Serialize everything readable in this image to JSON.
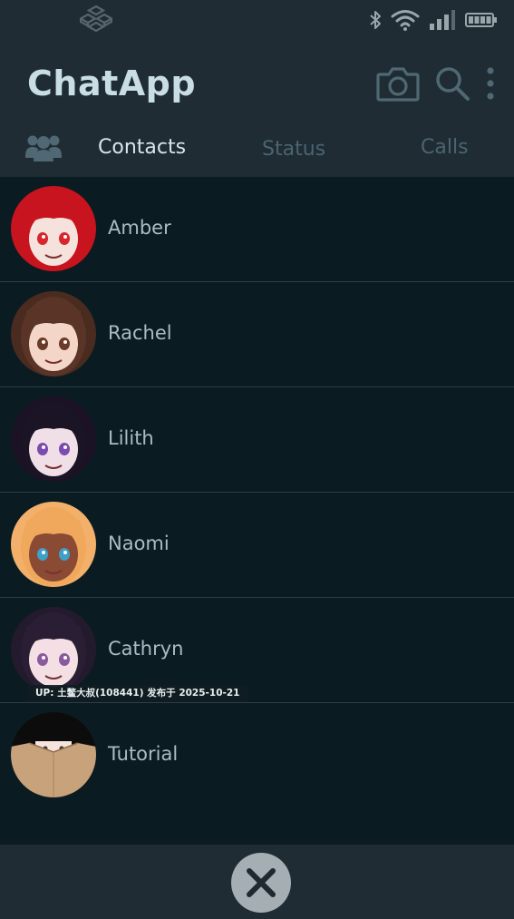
{
  "app": {
    "title": "ChatApp"
  },
  "statusbar": {
    "icons": [
      "app-logo-icon",
      "bluetooth-icon",
      "wifi-icon",
      "signal-icon",
      "battery-icon"
    ]
  },
  "header": {
    "actions": [
      "camera-icon",
      "search-icon",
      "more-vert-icon"
    ]
  },
  "tabs": {
    "community_icon": "community-icon",
    "items": [
      {
        "label": "Contacts",
        "active": true
      },
      {
        "label": "Status",
        "active": false
      },
      {
        "label": "Calls",
        "active": false
      }
    ]
  },
  "contacts": [
    {
      "name": "Amber",
      "hair": "#c8141e",
      "eyes": "#d8262c",
      "skin": "#f6e2dc",
      "bg": "#c8141e"
    },
    {
      "name": "Rachel",
      "hair": "#5a3527",
      "eyes": "#6b3a28",
      "skin": "#f3d6c8",
      "bg": "#4a2b20"
    },
    {
      "name": "Lilith",
      "hair": "#1a1424",
      "eyes": "#7c4bb0",
      "skin": "#f1dfe8",
      "bg": "#1b1226"
    },
    {
      "name": "Naomi",
      "hair": "#f0a85c",
      "eyes": "#3ea0c8",
      "skin": "#8a4a34",
      "bg": "#f3b06a"
    },
    {
      "name": "Cathryn",
      "hair": "#2a1e34",
      "eyes": "#8a5a9c",
      "skin": "#f4e0e4",
      "bg": "#241a2e"
    },
    {
      "name": "Tutorial",
      "hair": "#0c0c0c",
      "eyes": "#3a3030",
      "skin": "#f6e4dc",
      "bg": "#0c0c0c"
    }
  ],
  "overlay": {
    "watermark": "UP: 土鳖大叔(108441) 发布于 2025-10-21"
  },
  "bottom": {
    "close_icon": "close-icon"
  },
  "colors": {
    "header_bg": "#1f2c34",
    "list_bg": "#0b1b22",
    "title": "#c9dde4",
    "tab_active": "#d7e6ec",
    "tab_inactive": "#4b6470",
    "contact_name": "#a9bcc4"
  }
}
